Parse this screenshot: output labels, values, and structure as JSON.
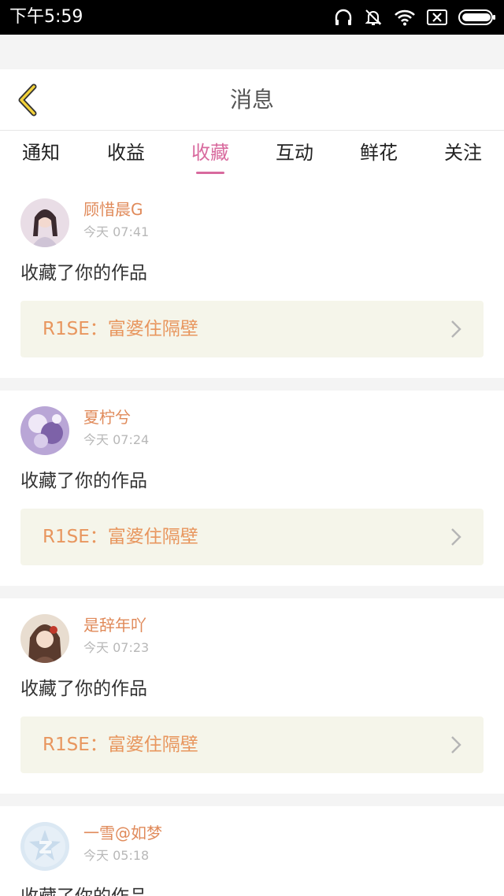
{
  "status_bar": {
    "time": "下午5:59"
  },
  "header": {
    "title": "消息"
  },
  "tabs": [
    {
      "label": "通知"
    },
    {
      "label": "收益"
    },
    {
      "label": "收藏",
      "active": true
    },
    {
      "label": "互动"
    },
    {
      "label": "鲜花"
    },
    {
      "label": "关注"
    }
  ],
  "messages": [
    {
      "user": "顾惜晨G",
      "time": "今天 07:41",
      "action": "收藏了你的作品",
      "work": "R1SE：富婆住隔壁"
    },
    {
      "user": "夏柠兮",
      "time": "今天 07:24",
      "action": "收藏了你的作品",
      "work": "R1SE：富婆住隔壁"
    },
    {
      "user": "是辞年吖",
      "time": "今天 07:23",
      "action": "收藏了你的作品",
      "work": "R1SE：富婆住隔壁"
    },
    {
      "user": "一雪@如梦",
      "time": "今天 05:18",
      "action": "收藏了你的作品",
      "work": ""
    }
  ],
  "colors": {
    "accent": "#d86a9e",
    "name": "#e08a5a",
    "work": "#e8965e",
    "work_bg": "#f5f5ea"
  },
  "icons": [
    "headphones-icon",
    "bell-off-icon",
    "wifi-icon",
    "sim-off-icon",
    "battery-icon",
    "back-arrow-icon",
    "chevron-right-icon"
  ]
}
